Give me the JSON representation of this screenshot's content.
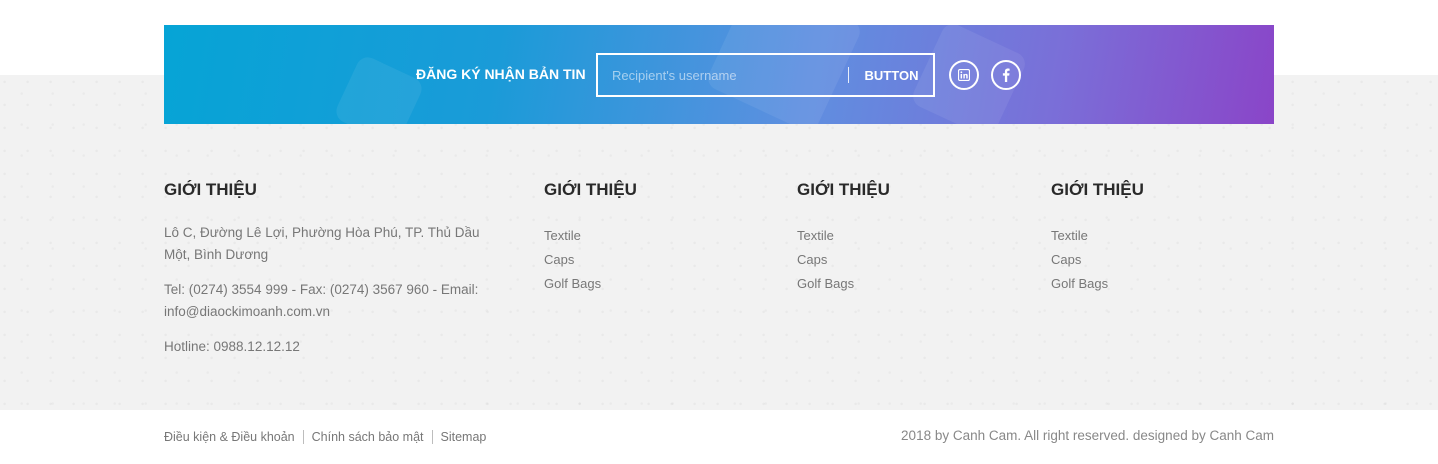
{
  "newsletter": {
    "label": "ĐĂNG KÝ NHẬN BẢN TIN",
    "input_placeholder": "Recipient's username",
    "button_label": "BUTTON",
    "social": [
      {
        "icon": "linkedin-icon",
        "glyph": "in"
      },
      {
        "icon": "facebook-icon",
        "glyph": "f"
      }
    ]
  },
  "footer": {
    "about": {
      "title": "GIỚI THIỆU",
      "address": "Lô C, Đường Lê Lợi, Phường Hòa Phú, TP. Thủ Dầu Một, Bình Dương",
      "contact": "Tel: (0274) 3554 999 - Fax: (0274) 3567 960 - Email: info@diaockimoanh.com.vn",
      "hotline": "Hotline: 0988.12.12.12"
    },
    "columns": [
      {
        "title": "GIỚI THIỆU",
        "links": [
          "Textile",
          "Caps",
          "Golf Bags"
        ]
      },
      {
        "title": "GIỚI THIỆU",
        "links": [
          "Textile",
          "Caps",
          "Golf Bags"
        ]
      },
      {
        "title": "GIỚI THIỆU",
        "links": [
          "Textile",
          "Caps",
          "Golf Bags"
        ]
      }
    ]
  },
  "bottom": {
    "legal_links": [
      "Điều kiện & Điều khoản",
      "Chính sách bảo mật",
      "Sitemap"
    ],
    "copyright": "2018 by Canh Cam. All right reserved. designed by Canh Cam"
  },
  "colors": {
    "gradient_start": "#06a4d6",
    "gradient_end": "#8a45c8",
    "footer_bg": "#f2f2f2"
  }
}
